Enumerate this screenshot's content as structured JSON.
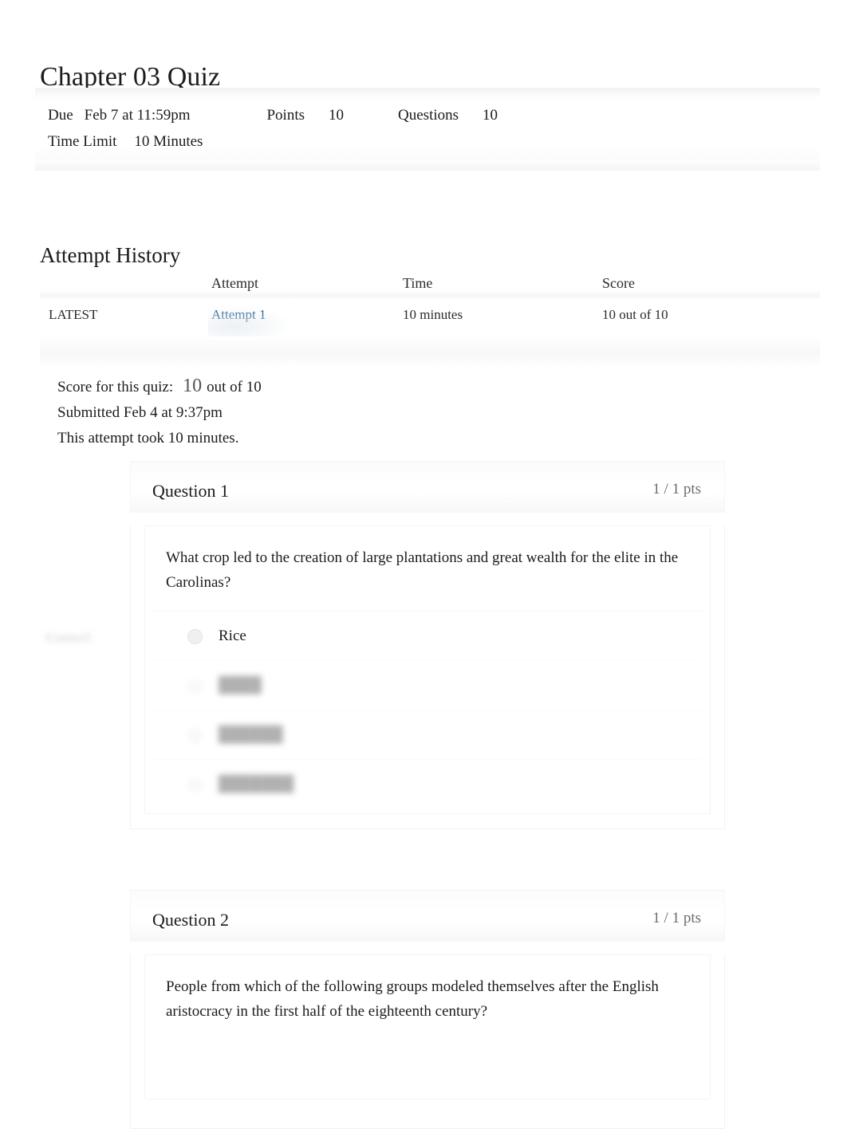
{
  "quiz": {
    "title": "Chapter 03 Quiz",
    "meta": {
      "due_label": "Due",
      "due_value": "Feb 7 at 11:59pm",
      "points_label": "Points",
      "points_value": "10",
      "questions_label": "Questions",
      "questions_value": "10",
      "time_limit_label": "Time Limit",
      "time_limit_value": "10 Minutes"
    }
  },
  "attempt_history": {
    "heading": "Attempt History",
    "columns": [
      "",
      "Attempt",
      "Time",
      "Score"
    ],
    "rows": [
      {
        "marker": "LATEST",
        "attempt": "Attempt 1",
        "time": "10 minutes",
        "score": "10 out of 10"
      }
    ]
  },
  "score_summary": {
    "score_label": "Score for this quiz:",
    "score_value": "10",
    "score_out_of": "out of 10",
    "submitted": "Submitted Feb 4 at 9:37pm",
    "duration": "This attempt took 10 minutes."
  },
  "questions": [
    {
      "title": "Question 1",
      "points": "1 / 1 pts",
      "correct_marker": "Correct!",
      "text": "What crop led to the creation of large plantations and great wealth for the elite in the Carolinas?",
      "answers": [
        {
          "label": "Rice",
          "redacted": false
        },
        {
          "label": "",
          "redacted": true
        },
        {
          "label": "",
          "redacted": true
        },
        {
          "label": "",
          "redacted": true
        }
      ]
    },
    {
      "title": "Question 2",
      "points": "1 / 1 pts",
      "text": "People from which of the following groups modeled themselves after the English aristocracy in the first half of the eighteenth century?",
      "answers": []
    }
  ],
  "colors": {
    "link": "#1b5e91",
    "muted": "#6b6b6b",
    "text": "#1b1b1b"
  }
}
